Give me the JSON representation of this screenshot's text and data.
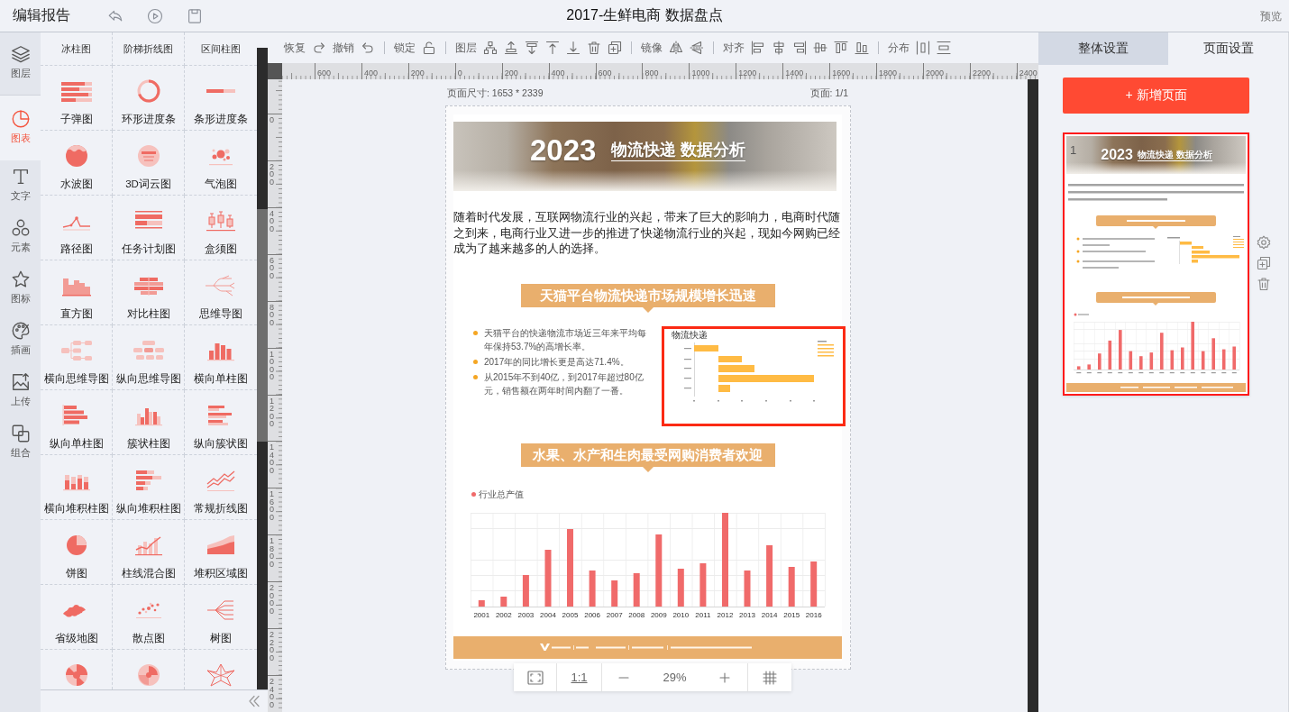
{
  "header": {
    "app_title": "编辑报告",
    "document_title": "2017-生鲜电商 数据盘点",
    "preview": "预览"
  },
  "rail": [
    {
      "label": "图层",
      "selected": false
    },
    {
      "label": "图表",
      "selected": true
    },
    {
      "label": "文字",
      "selected": false
    },
    {
      "label": "元素",
      "selected": false
    },
    {
      "label": "图标",
      "selected": false
    },
    {
      "label": "插画",
      "selected": false
    },
    {
      "label": "上传",
      "selected": false
    },
    {
      "label": "组合",
      "selected": false
    }
  ],
  "palette": {
    "top_row": [
      "冰柱图",
      "阶梯折线图",
      "区间柱图"
    ],
    "items": [
      "子弹图",
      "环形进度条",
      "条形进度条",
      "水波图",
      "3D词云图",
      "气泡图",
      "路径图",
      "任务计划图",
      "盒须图",
      "直方图",
      "对比柱图",
      "思维导图",
      "横向思维导图",
      "纵向思维导图",
      "横向单柱图",
      "纵向单柱图",
      "簇状柱图",
      "纵向簇状图",
      "横向堆积柱图",
      "纵向堆积柱图",
      "常规折线图",
      "饼图",
      "柱线混合图",
      "堆积区域图",
      "省级地图",
      "散点图",
      "树图"
    ]
  },
  "toolbar": [
    [
      "恢复",
      "撤销"
    ],
    [
      "锁定"
    ],
    [
      "图层"
    ],
    [
      "镜像"
    ],
    [
      "对齐"
    ],
    [
      "分布"
    ]
  ],
  "rulers": {
    "horizontal": [
      "600",
      "400",
      "200",
      "0",
      "200",
      "400",
      "600",
      "800",
      "1000",
      "1200",
      "1400",
      "1600",
      "1800",
      "2000",
      "2200",
      "2400"
    ],
    "vertical": [
      "0",
      "200",
      "400",
      "600",
      "800",
      "1000",
      "1200",
      "1400",
      "1600",
      "1800",
      "2000",
      "2200",
      "2400"
    ]
  },
  "page": {
    "size_label": "页面尺寸: 1653 * 2339",
    "page_label": "页面: 1/1",
    "banner": {
      "year": "2023",
      "title": "物流快递 数据分析"
    },
    "intro": "随着时代发展，互联网物流行业的兴起，带来了巨大的影响力，电商时代随之到来，电商行业又进一步的推进了快递物流行业的兴起，现如今网购已经成为了越来越多的人的选择。",
    "sections": [
      {
        "title": "天猫平台物流快递市场规模增长迅速",
        "bullets": [
          "天猫平台的快递物流市场近三年来平均每年保持53.7%的高增长率。",
          "2017年的同比增长更是高达71.4%。",
          "从2015年不到40亿，到2017年超过80亿元，销售额在两年时间内翻了一番。"
        ],
        "chart": {
          "kind": "floating_bar",
          "title": "物流快递",
          "selected": true
        }
      },
      {
        "title": "水果、水产和生肉最受网购消费者欢迎",
        "chart": {
          "kind": "column",
          "legend": "行业总产值",
          "categories": [
            "2001",
            "2002",
            "2003",
            "2004",
            "2005",
            "2006",
            "2007",
            "2008",
            "2009",
            "2010",
            "2011",
            "2012",
            "2013",
            "2014",
            "2015",
            "2016"
          ],
          "selected": false
        }
      }
    ]
  },
  "zoom": {
    "actual_size": "1:1",
    "level": "29%"
  },
  "right_panel": {
    "tabs": [
      {
        "label": "整体设置",
        "selected": false
      },
      {
        "label": "页面设置",
        "selected": true
      }
    ],
    "add_page": "+ 新增页面",
    "pages": [
      {
        "number": "1",
        "year": "2023",
        "title": "物流快递 数据分析",
        "selected": true
      }
    ]
  }
}
